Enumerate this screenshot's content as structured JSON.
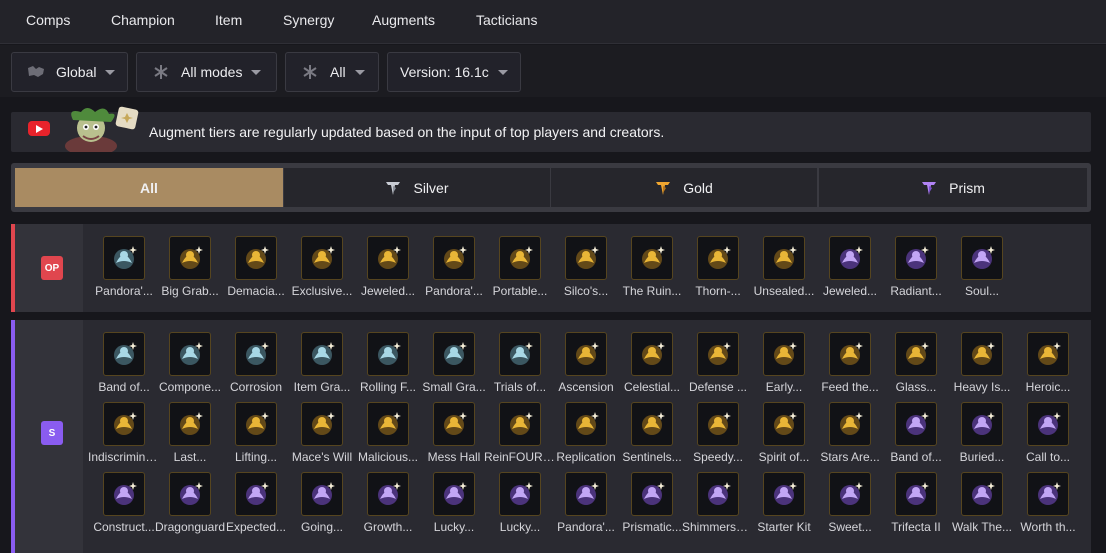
{
  "nav": [
    {
      "label": "Comps",
      "name": "nav-comps"
    },
    {
      "label": "Champion",
      "name": "nav-champion"
    },
    {
      "label": "Item",
      "name": "nav-item"
    },
    {
      "label": "Synergy",
      "name": "nav-synergy"
    },
    {
      "label": "Augments",
      "name": "nav-augments"
    },
    {
      "label": "Tacticians",
      "name": "nav-tacticians"
    }
  ],
  "filters": {
    "region": "Global",
    "mode": "All modes",
    "filter": "All",
    "version": "Version: 16.1c"
  },
  "notice": {
    "text": "Augment tiers are regularly updated based on the input of top players and creators."
  },
  "tabs": [
    {
      "label": "All",
      "icon": "",
      "color": ""
    },
    {
      "label": "Silver",
      "icon": "silver-tier-icon",
      "color": "#c8ccd4"
    },
    {
      "label": "Gold",
      "icon": "gold-tier-icon",
      "color": "#f0a630"
    },
    {
      "label": "Prism",
      "icon": "prism-tier-icon",
      "color": "#b183f5"
    }
  ],
  "colors": {
    "accent": "#a98b62",
    "op_tier": "#e0464e",
    "s_tier": "#8a5cf0",
    "gold_icon": "#e9b637",
    "prism_icon": "#c2a6f5",
    "silver_icon": "#a8d8e6"
  },
  "tiers": [
    {
      "label": "OP",
      "color": "#e0464e",
      "augments": [
        {
          "name": "Pandora'...",
          "kind": "silver"
        },
        {
          "name": "Big Grab...",
          "kind": "gold"
        },
        {
          "name": "Demacia...",
          "kind": "gold"
        },
        {
          "name": "Exclusive...",
          "kind": "gold"
        },
        {
          "name": "Jeweled...",
          "kind": "gold"
        },
        {
          "name": "Pandora'...",
          "kind": "gold"
        },
        {
          "name": "Portable...",
          "kind": "gold"
        },
        {
          "name": "Silco's...",
          "kind": "gold"
        },
        {
          "name": "The Ruin...",
          "kind": "gold"
        },
        {
          "name": "Thorn-...",
          "kind": "gold"
        },
        {
          "name": "Unsealed...",
          "kind": "gold"
        },
        {
          "name": "Jeweled...",
          "kind": "prism"
        },
        {
          "name": "Radiant...",
          "kind": "prism"
        },
        {
          "name": "Soul...",
          "kind": "prism"
        }
      ]
    },
    {
      "label": "S",
      "color": "#8a5cf0",
      "augments": [
        {
          "name": "Band of...",
          "kind": "silver"
        },
        {
          "name": "Compone...",
          "kind": "silver"
        },
        {
          "name": "Corrosion",
          "kind": "silver"
        },
        {
          "name": "Item Gra...",
          "kind": "silver"
        },
        {
          "name": "Rolling F...",
          "kind": "silver"
        },
        {
          "name": "Small Gra...",
          "kind": "silver"
        },
        {
          "name": "Trials of...",
          "kind": "silver"
        },
        {
          "name": "Ascension",
          "kind": "gold"
        },
        {
          "name": "Celestial...",
          "kind": "gold"
        },
        {
          "name": "Defense ...",
          "kind": "gold"
        },
        {
          "name": "Early...",
          "kind": "gold"
        },
        {
          "name": "Feed the...",
          "kind": "gold"
        },
        {
          "name": "Glass...",
          "kind": "gold"
        },
        {
          "name": "Heavy Is...",
          "kind": "gold"
        },
        {
          "name": "Heroic...",
          "kind": "gold"
        },
        {
          "name": "Indiscrimina...",
          "kind": "gold"
        },
        {
          "name": "Last...",
          "kind": "gold"
        },
        {
          "name": "Lifting...",
          "kind": "gold"
        },
        {
          "name": "Mace's Will",
          "kind": "gold"
        },
        {
          "name": "Malicious...",
          "kind": "gold"
        },
        {
          "name": "Mess Hall",
          "kind": "gold"
        },
        {
          "name": "ReinFOURcement",
          "kind": "gold"
        },
        {
          "name": "Replication",
          "kind": "gold"
        },
        {
          "name": "Sentinels...",
          "kind": "gold"
        },
        {
          "name": "Speedy...",
          "kind": "gold"
        },
        {
          "name": "Spirit of...",
          "kind": "gold"
        },
        {
          "name": "Stars Are...",
          "kind": "gold"
        },
        {
          "name": "Band of...",
          "kind": "prism"
        },
        {
          "name": "Buried...",
          "kind": "prism"
        },
        {
          "name": "Call to...",
          "kind": "prism"
        },
        {
          "name": "Construct...",
          "kind": "prism"
        },
        {
          "name": "Dragonguard",
          "kind": "prism"
        },
        {
          "name": "Expected...",
          "kind": "prism"
        },
        {
          "name": "Going...",
          "kind": "prism"
        },
        {
          "name": "Growth...",
          "kind": "prism"
        },
        {
          "name": "Lucky...",
          "kind": "prism"
        },
        {
          "name": "Lucky...",
          "kind": "prism"
        },
        {
          "name": "Pandora'...",
          "kind": "prism"
        },
        {
          "name": "Prismatic...",
          "kind": "prism"
        },
        {
          "name": "Shimmersca...",
          "kind": "prism"
        },
        {
          "name": "Starter Kit",
          "kind": "prism"
        },
        {
          "name": "Sweet...",
          "kind": "prism"
        },
        {
          "name": "Trifecta II",
          "kind": "prism"
        },
        {
          "name": "Walk The...",
          "kind": "prism"
        },
        {
          "name": "Worth th...",
          "kind": "prism"
        }
      ]
    }
  ]
}
